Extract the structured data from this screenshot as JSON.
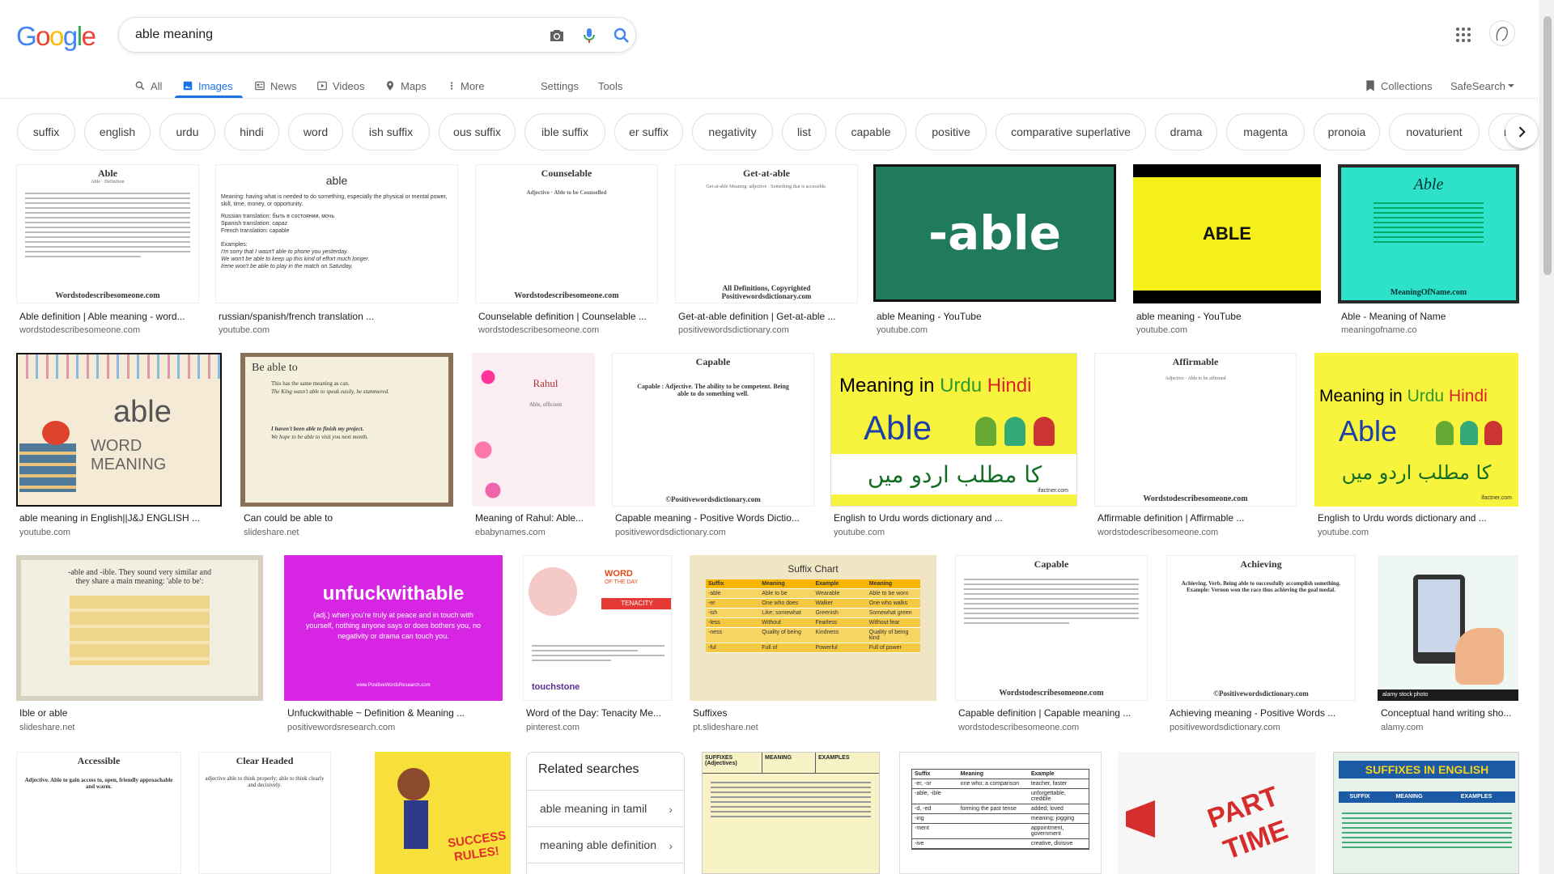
{
  "logo_letters": [
    {
      "t": "G",
      "c": "#4285f4"
    },
    {
      "t": "o",
      "c": "#ea4335"
    },
    {
      "t": "o",
      "c": "#fbbc05"
    },
    {
      "t": "g",
      "c": "#4285f4"
    },
    {
      "t": "l",
      "c": "#34a853"
    },
    {
      "t": "e",
      "c": "#ea4335"
    }
  ],
  "search": {
    "query": "able meaning"
  },
  "tabs": {
    "all": "All",
    "images": "Images",
    "news": "News",
    "videos": "Videos",
    "maps": "Maps",
    "more": "More",
    "settings": "Settings",
    "tools": "Tools",
    "collections": "Collections",
    "safesearch": "SafeSearch"
  },
  "chips": [
    "suffix",
    "english",
    "urdu",
    "hindi",
    "word",
    "ish suffix",
    "ous suffix",
    "ible suffix",
    "er suffix",
    "negativity",
    "list",
    "capable",
    "positive",
    "comparative superlative",
    "drama",
    "magenta",
    "pronoia",
    "novaturient",
    "m"
  ],
  "results": [
    {
      "title": "Able definition | Able meaning - word...",
      "source": "wordstodescribesomeone.com"
    },
    {
      "title": "russian/spanish/french translation ...",
      "source": "youtube.com"
    },
    {
      "title": "Counselable definition | Counselable ...",
      "source": "wordstodescribesomeone.com"
    },
    {
      "title": "Get-at-able definition | Get-at-able ...",
      "source": "positivewordsdictionary.com"
    },
    {
      "title": "able Meaning - YouTube",
      "source": "youtube.com"
    },
    {
      "title": "able meaning - YouTube",
      "source": "youtube.com"
    },
    {
      "title": "Able - Meaning of Name",
      "source": "meaningofname.co"
    },
    {
      "title": "able meaning in English||J&J ENGLISH ...",
      "source": "youtube.com"
    },
    {
      "title": "Can could be able to",
      "source": "slideshare.net"
    },
    {
      "title": "Meaning of Rahul: Able...",
      "source": "ebabynames.com"
    },
    {
      "title": "Capable meaning - Positive Words Dictio...",
      "source": "positivewordsdictionary.com"
    },
    {
      "title": "English to Urdu words dictionary and ...",
      "source": "youtube.com"
    },
    {
      "title": "Affirmable definition | Affirmable ...",
      "source": "wordstodescribesomeone.com"
    },
    {
      "title": "English to Urdu words dictionary and ...",
      "source": "youtube.com"
    },
    {
      "title": "Ible or able",
      "source": "slideshare.net"
    },
    {
      "title": "Unfuckwithable ~ Definition & Meaning ...",
      "source": "positivewordsresearch.com"
    },
    {
      "title": "Word of the Day: Tenacity Me...",
      "source": "pinterest.com"
    },
    {
      "title": "Suffixes",
      "source": "pt.slideshare.net"
    },
    {
      "title": "Capable definition | Capable meaning ...",
      "source": "wordstodescribesomeone.com"
    },
    {
      "title": "Achieving meaning - Positive Words ...",
      "source": "positivewordsdictionary.com"
    },
    {
      "title": "Conceptual hand writing sho...",
      "source": "alamy.com"
    }
  ],
  "thumb_text": {
    "able_doc_h": "Able",
    "able_doc_sub": "Able · Definition",
    "wds_foot": "Wordstodescribesomeone.com",
    "able_plain_h": "able",
    "able_plain_body": "Meaning: having what is needed to do something, especially the physical or mental power, skill, time, money, or opportunity.",
    "able_plain_ru": "Russian translation: быть в состоянии, мочь",
    "able_plain_es": "Spanish translation: capaz",
    "able_plain_fr": "French translation: capable",
    "able_plain_ex": "Examples:",
    "able_plain_ex1": "I'm sorry that I wasn't able to phone you yesterday.",
    "able_plain_ex2": "We won't be able to keep up this kind of effort much longer.",
    "able_plain_ex3": "Irene won't be able to play in the match on Saturday.",
    "counselable_h": "Counselable",
    "counselable_def": "Adjective · Able to be Counselled",
    "getatable_h": "Get-at-able",
    "getatable_def": "Get-at-able Meaning: adjective · Something that is accessible.",
    "getatable_foot": "All Definitions, Copyrighted",
    "pwd_foot": "Positivewordsdictionary.com",
    "yt_able": "-able",
    "yellow_able": "ABLE",
    "meaningofname_h": "Able",
    "meaningofname_foot": "MeaningOfName.com",
    "word_meaning_1": "able",
    "word_meaning_2": "WORD MEANING",
    "beable_h": "Be able to",
    "beable_l1": "This has the same meaning as can.",
    "beable_l2": "The King wasn't able to speak easily, he stammered.",
    "beable_l3": "I haven't been able to finish my project.",
    "beable_l4": "We hope to be able to visit you next month.",
    "rahul": "Rahul",
    "rahul_sub": "Able, efficient",
    "capable_h": "Capable",
    "capable_def": "Capable : Adjective. The ability to be competent. Being able to do something well.",
    "capable_foot": "©Positivewordsdictionary.com",
    "urdu_l1a": "Meaning in ",
    "urdu_l1b": "Urdu ",
    "urdu_l1c": "Hindi",
    "urdu_able": "Able",
    "urdu_script": "کا مطلب اردو میں",
    "urdu_credit": "ifactner.com",
    "affirmable_h": "Affirmable",
    "affirmable_def": "Adjective · Able to be affirmed",
    "ible_l1": "-able and -ible. They sound very similar and",
    "ible_l2": "they share a main meaning: 'able to be':",
    "unf_h": "unfuckwithable",
    "unf_body": "(adj.) when you're truly at peace and in touch with yourself, nothing anyone says or does bothers you, no negativity or drama can touch you.",
    "unf_url": "www.PositiveWordsResearch.com",
    "wotd_1": "WORD",
    "wotd_2": "OF THE DAY",
    "wotd_word": "TENACITY",
    "wotd_brand": "touchstone",
    "suffix_chart_h": "Suffix Chart",
    "suffix_cols": [
      "Suffix",
      "Meaning",
      "Example",
      "Meaning"
    ],
    "suffix_rows": [
      [
        "-able",
        "Able to be",
        "Wearable",
        "Able to be worn"
      ],
      [
        "-er",
        "One who does",
        "Walker",
        "One who walks"
      ],
      [
        "-ish",
        "Like; somewhat",
        "Greenish",
        "Somewhat green"
      ],
      [
        "-less",
        "Without",
        "Fearless",
        "Without fear"
      ],
      [
        "-ness",
        "Quality of being",
        "Kindness",
        "Quality of being kind"
      ],
      [
        "-ful",
        "Full of",
        "Powerful",
        "Full of power"
      ]
    ],
    "capable2_h": "Capable",
    "achieving_h": "Achieving",
    "achieving_def": "Achieving. Verb. Being able to successfully accomplish something. Example: Vernon won the race thus achieving the goal medal.",
    "alamy": "alamy stock photo",
    "accessible_h": "Accessible",
    "accessible_def": "Adjective. Able to gain access to, open, friendly approachable and warm.",
    "clearheaded_h": "Clear Headed",
    "clearheaded_def": "adjective able to think properly; able to think clearly and decisively.",
    "success_1": "SUCCESS",
    "success_2": "RULES!",
    "suffixes_table_h1": "SUFFIXES (Adjectives)",
    "suffixes_table_h2": "MEANING",
    "suffixes_table_h3": "EXAMPLES",
    "suffix_table2_h": [
      "Suffix",
      "Meaning",
      "Example"
    ],
    "suffix_table2_rows": [
      [
        "-er, -or",
        "one who; a comparison",
        "teacher, faster"
      ],
      [
        "-able, -ible",
        "",
        "unforgettable, credible"
      ],
      [
        "-d, -ed",
        "forming the past tense",
        "added; loved"
      ],
      [
        "-ing",
        "",
        "meaning; jogging"
      ],
      [
        "-ment",
        "",
        "appointment, government"
      ],
      [
        "-ive",
        "",
        "creative, divisive"
      ]
    ],
    "part_1": "PART",
    "part_2": "TIME",
    "suffixes_english": "SUFFIXES IN ENGLISH",
    "suffixes_english_cols": [
      "SUFFIX",
      "MEANING",
      "EXAMPLES"
    ]
  },
  "related": {
    "title": "Related searches",
    "items": [
      "able meaning in tamil",
      "meaning able definition"
    ]
  }
}
